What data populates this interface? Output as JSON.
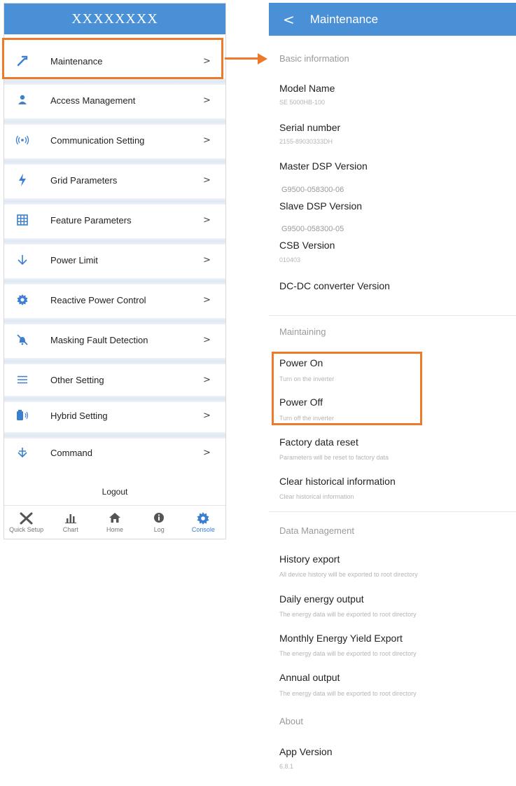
{
  "left": {
    "header_title": "XXXXXXXX",
    "menu": [
      {
        "icon": "hammer-icon",
        "glyph": "⚒",
        "label": "Maintenance",
        "chev": ">"
      },
      {
        "icon": "person-icon",
        "glyph": "👤",
        "label": "Access Management",
        "chev": ">"
      },
      {
        "icon": "signal-icon",
        "glyph": "((•))",
        "label": "Communication Setting",
        "chev": ">"
      },
      {
        "icon": "bolt-icon",
        "glyph": "⚡",
        "label": "Grid Parameters",
        "chev": ">"
      },
      {
        "icon": "grid-icon",
        "glyph": "▦",
        "label": "Feature Parameters",
        "chev": ">"
      },
      {
        "icon": "down-arrow-icon",
        "glyph": "↓",
        "label": "Power Limit",
        "chev": ">"
      },
      {
        "icon": "gear-icon",
        "glyph": "⚙",
        "label": "Reactive Power Control",
        "chev": ">"
      },
      {
        "icon": "bell-off-icon",
        "glyph": "🔕",
        "label": "Masking Fault Detection",
        "chev": ">"
      },
      {
        "icon": "list-icon",
        "glyph": "≡",
        "label": "Other Setting",
        "chev": ">"
      },
      {
        "icon": "battery-icon",
        "glyph": "▮",
        "label": "Hybrid Setting",
        "chev": ">"
      },
      {
        "icon": "down-arrow-icon",
        "glyph": "↓",
        "label": "Command",
        "chev": ">"
      }
    ],
    "logout": "Logout",
    "nav": [
      {
        "icon": "tools-icon",
        "glyph": "✕",
        "label": "Quick Setup",
        "active": false
      },
      {
        "icon": "chart-icon",
        "glyph": "▮▮",
        "label": "Chart",
        "active": false
      },
      {
        "icon": "home-icon",
        "glyph": "⌂",
        "label": "Home",
        "active": false
      },
      {
        "icon": "info-icon",
        "glyph": "●",
        "label": "Log",
        "active": false
      },
      {
        "icon": "gear-icon",
        "glyph": "⚙",
        "label": "Console",
        "active": true
      }
    ]
  },
  "right": {
    "header_title": "Maintenance",
    "back": "<",
    "sections": {
      "basic": "Basic information",
      "maintaining": "Maintaining",
      "data": "Data Management",
      "about": "About"
    },
    "basic": [
      {
        "title": "Model Name",
        "sub": "SE 5000HB-100"
      },
      {
        "title": "Serial number",
        "sub": "2155-89030333DH"
      },
      {
        "title": "Master DSP Version",
        "sub": "G9500-058300-06"
      },
      {
        "title": "Slave DSP Version",
        "sub": "G9500-058300-05"
      },
      {
        "title": "CSB Version",
        "sub": "010403"
      },
      {
        "title": "DC-DC converter Version",
        "sub": ""
      }
    ],
    "maintaining": [
      {
        "title": "Power On",
        "sub": "Turn on the inverter"
      },
      {
        "title": "Power Off",
        "sub": "Turn off the inverter"
      },
      {
        "title": "Factory data reset",
        "sub": "Parameters will be reset to factory data"
      },
      {
        "title": "Clear historical information",
        "sub": "Clear historical information"
      }
    ],
    "data_mgmt": [
      {
        "title": "History export",
        "sub": "All device history will be exported to root directory"
      },
      {
        "title": "Daily energy output",
        "sub": "The energy data will be exported to root directory"
      },
      {
        "title": "Monthly Energy Yield Export",
        "sub": "The energy data will be exported to root directory"
      },
      {
        "title": "Annual output",
        "sub": "The energy data will be exported to root directory"
      }
    ],
    "about": [
      {
        "title": "App Version",
        "sub": "6.8.1"
      }
    ]
  },
  "colors": {
    "header_blue": "#4a90d6",
    "icon_blue": "#3b7fd1",
    "highlight_orange": "#ec7a2a"
  }
}
